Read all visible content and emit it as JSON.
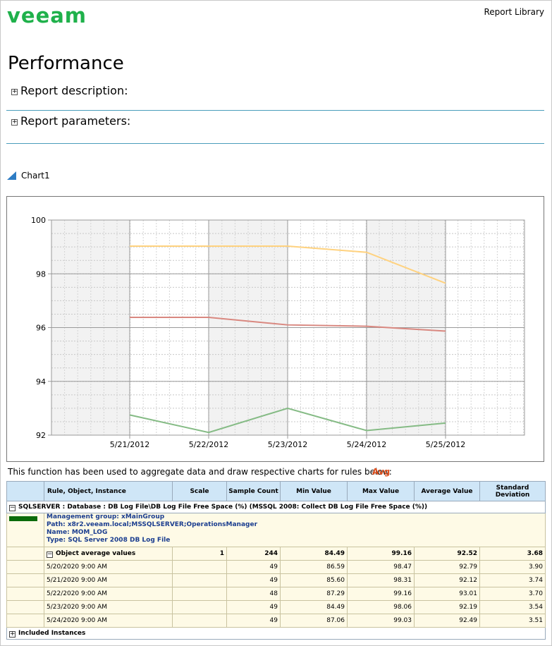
{
  "header": {
    "logo_text": "veeam",
    "report_library": "Report Library"
  },
  "page_title": "Performance",
  "sections": {
    "description": "Report description:",
    "parameters": "Report parameters:"
  },
  "chart_section_title": "Chart1",
  "chart_data": {
    "type": "line",
    "x": [
      "5/21/2012",
      "5/22/2012",
      "5/23/2012",
      "5/24/2012",
      "5/25/2012"
    ],
    "ylim": [
      92,
      100
    ],
    "y_ticks": [
      "100",
      "98",
      "96",
      "94",
      "92"
    ],
    "grid": true,
    "series": [
      {
        "color": "#ffd27f",
        "values": [
          99.03,
          99.03,
          99.03,
          98.8,
          97.65
        ]
      },
      {
        "color": "#d98880",
        "values": [
          96.38,
          96.38,
          96.1,
          96.05,
          95.87
        ]
      },
      {
        "color": "#85bb85",
        "values": [
          92.75,
          92.1,
          93.0,
          92.17,
          92.45
        ]
      }
    ]
  },
  "aggregation": {
    "note": "This function has been used to aggregate data and draw respective charts for rules below:",
    "function": "Avg"
  },
  "table": {
    "headers": {
      "rule": "Rule, Object, Instance",
      "scale": "Scale",
      "sample_count": "Sample Count",
      "min": "Min Value",
      "max": "Max Value",
      "avg": "Average Value",
      "std": "Standard Deviation"
    },
    "group_label": "SQLSERVER : Database : DB Log File\\DB Log File Free Space (%) (MSSQL 2008: Collect DB Log File Free Space (%))",
    "info": {
      "swatch_color": "#0b6b0b",
      "management_group": "Management group: xMainGroup",
      "path": "Path: x8r2.veeam.local;MSSQLSERVER;OperationsManager",
      "name": "Name: MOM_LOG",
      "type": "Type: SQL Server 2008 DB Log File"
    },
    "object_avg": {
      "label": "Object average values",
      "scale": "1",
      "sample_count": "244",
      "min": "84.49",
      "max": "99.16",
      "avg": "92.52",
      "std": "3.68"
    },
    "rows": [
      {
        "date": "5/20/2020 9:00 AM",
        "sample_count": "49",
        "min": "86.59",
        "max": "98.47",
        "avg": "92.79",
        "std": "3.90"
      },
      {
        "date": "5/21/2020 9:00 AM",
        "sample_count": "49",
        "min": "85.60",
        "max": "98.31",
        "avg": "92.12",
        "std": "3.74"
      },
      {
        "date": "5/22/2020 9:00 AM",
        "sample_count": "48",
        "min": "87.29",
        "max": "99.16",
        "avg": "93.01",
        "std": "3.70"
      },
      {
        "date": "5/23/2020 9:00 AM",
        "sample_count": "49",
        "min": "84.49",
        "max": "98.06",
        "avg": "92.19",
        "std": "3.54"
      },
      {
        "date": "5/24/2020 9:00 AM",
        "sample_count": "49",
        "min": "87.06",
        "max": "99.03",
        "avg": "92.49",
        "std": "3.51"
      }
    ],
    "included_instances": "Included Instances"
  }
}
